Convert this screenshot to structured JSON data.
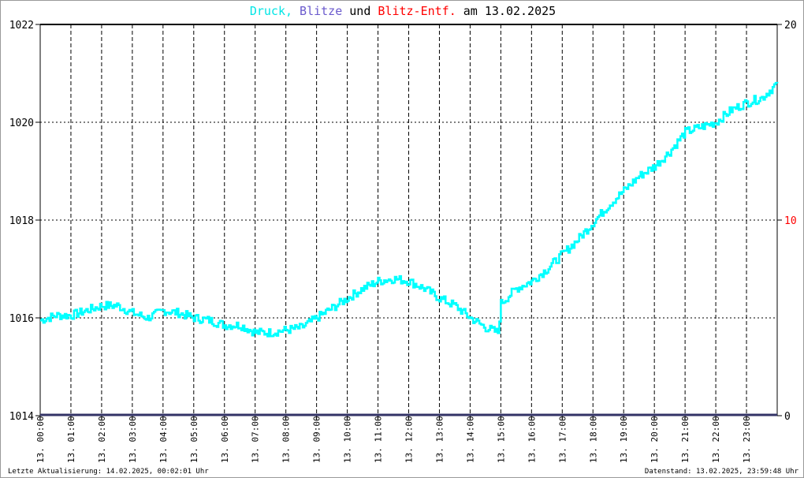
{
  "title": {
    "part1": "Druck,",
    "part2": "Blitze",
    "part3": "und",
    "part4": "Blitz-Entf.",
    "part5": "am 13.02.2025"
  },
  "colors": {
    "druck": "#00ffff",
    "blitze": "#6a5acd",
    "entf": "#ff0000",
    "axis": "#000000",
    "grid": "#000000"
  },
  "footer": {
    "left": "Letzte Aktualisierung: 14.02.2025, 00:02:01 Uhr",
    "right": "Datenstand: 13.02.2025, 23:59:48 Uhr"
  },
  "chart_data": {
    "type": "line",
    "title": "Druck, Blitze und Blitz-Entf. am 13.02.2025",
    "x_ticks": [
      "13. 00:00",
      "13. 01:00",
      "13. 02:00",
      "13. 03:00",
      "13. 04:00",
      "13. 05:00",
      "13. 06:00",
      "13. 07:00",
      "13. 08:00",
      "13. 09:00",
      "13. 10:00",
      "13. 11:00",
      "13. 12:00",
      "13. 13:00",
      "13. 14:00",
      "13. 15:00",
      "13. 16:00",
      "13. 17:00",
      "13. 18:00",
      "13. 19:00",
      "13. 20:00",
      "13. 21:00",
      "13. 22:00",
      "13. 23:00"
    ],
    "xlim_hours": [
      0,
      24
    ],
    "y_left": {
      "ticks": [
        "1014",
        "1016",
        "1018",
        "1020",
        "1022"
      ],
      "ylim": [
        1014,
        1022
      ]
    },
    "y_right": {
      "ticks": [
        "0",
        "10",
        "20"
      ],
      "ylim": [
        0,
        20
      ],
      "highlight": "10"
    },
    "series": [
      {
        "name": "Druck",
        "x_hours": [
          0,
          0.5,
          1,
          1.5,
          2,
          2.5,
          3,
          3.5,
          4,
          4.5,
          5,
          5.5,
          6,
          6.5,
          7,
          7.5,
          8,
          8.5,
          9,
          9.5,
          10,
          10.5,
          11,
          11.5,
          12,
          12.5,
          13,
          13.5,
          14,
          14.5,
          14.9,
          15,
          15.5,
          16,
          16.5,
          17,
          17.5,
          18,
          18.5,
          19,
          19.5,
          20,
          20.5,
          21,
          21.5,
          22,
          22.5,
          23,
          23.5,
          24
        ],
        "values": [
          1015.95,
          1016.05,
          1016.05,
          1016.15,
          1016.25,
          1016.25,
          1016.1,
          1016.0,
          1016.15,
          1016.1,
          1016.0,
          1015.95,
          1015.85,
          1015.85,
          1015.7,
          1015.7,
          1015.75,
          1015.8,
          1016.0,
          1016.2,
          1016.4,
          1016.6,
          1016.75,
          1016.8,
          1016.75,
          1016.6,
          1016.4,
          1016.25,
          1016.0,
          1015.8,
          1015.7,
          1016.3,
          1016.6,
          1016.75,
          1017.0,
          1017.3,
          1017.6,
          1017.95,
          1018.3,
          1018.6,
          1018.9,
          1019.1,
          1019.4,
          1019.8,
          1019.9,
          1020.0,
          1020.25,
          1020.4,
          1020.5,
          1020.8
        ]
      },
      {
        "name": "Blitze",
        "constant": 0
      },
      {
        "name": "Blitz-Entf.",
        "values": []
      }
    ]
  }
}
